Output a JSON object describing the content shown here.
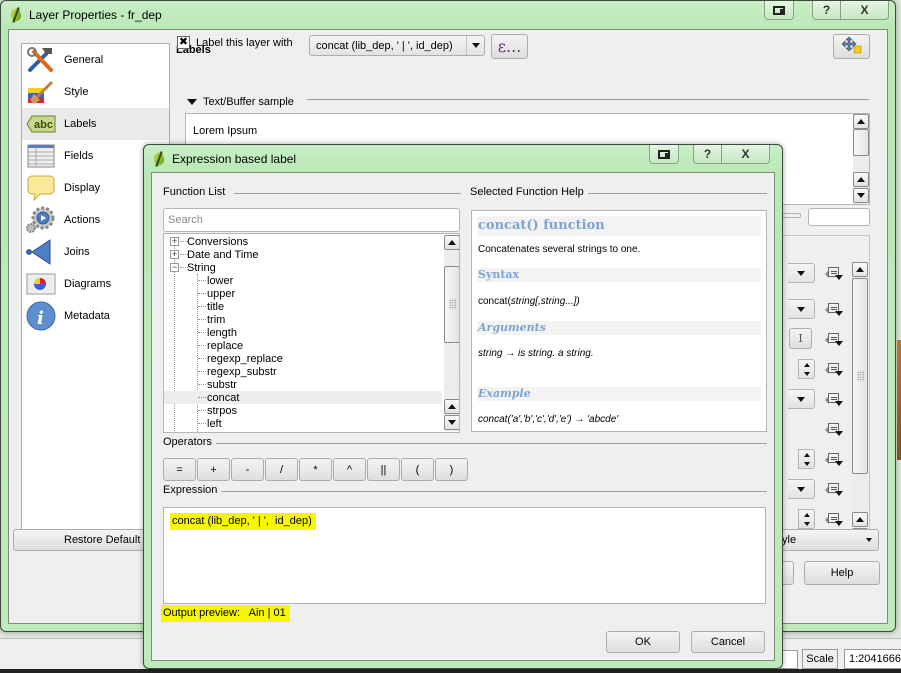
{
  "layer_properties": {
    "title": "Layer Properties - fr_dep",
    "caption": {
      "help": "?",
      "close": "X"
    },
    "sidebar": {
      "items": [
        {
          "label": "General",
          "icon": "hammer-wrench-icon"
        },
        {
          "label": "Style",
          "icon": "paint-brush-icon"
        },
        {
          "label": "Labels",
          "icon": "abc-label-icon",
          "active": true
        },
        {
          "label": "Fields",
          "icon": "table-icon"
        },
        {
          "label": "Display",
          "icon": "speech-bubble-icon"
        },
        {
          "label": "Actions",
          "icon": "gear-play-icon"
        },
        {
          "label": "Joins",
          "icon": "join-arrow-icon"
        },
        {
          "label": "Diagrams",
          "icon": "pie-chart-map-icon"
        },
        {
          "label": "Metadata",
          "icon": "info-icon"
        }
      ]
    },
    "labels_section": {
      "heading": "Labels",
      "checkbox_label": "Label this layer with",
      "checked": true,
      "label_field_value": "concat (lib_dep, ' | ',  id_dep)",
      "expression_button": "ε...",
      "sample_header": "Text/Buffer sample",
      "sample_text": "Lorem Ipsum"
    },
    "buttons": {
      "restore_defaults": "Restore Default",
      "style": "yle",
      "help": "Help"
    }
  },
  "statusbar": {
    "scale_label": "Scale",
    "scale_value": "1:2041666"
  },
  "expression_dialog": {
    "title": "Expression based label",
    "caption": {
      "help": "?",
      "close": "X"
    },
    "function_list": {
      "label": "Function List",
      "search_placeholder": "Search",
      "groups": [
        {
          "label": "Conversions",
          "expanded": false
        },
        {
          "label": "Date and Time",
          "expanded": false
        },
        {
          "label": "String",
          "expanded": true
        }
      ],
      "string_functions": [
        "lower",
        "upper",
        "title",
        "trim",
        "length",
        "replace",
        "regexp_replace",
        "regexp_substr",
        "substr",
        "concat",
        "strpos",
        "left"
      ],
      "selected": "concat"
    },
    "help": {
      "label": "Selected Function Help",
      "title": "concat() function",
      "description": "Concatenates several strings to one.",
      "syntax_heading": "Syntax",
      "syntax_fn": "concat(",
      "syntax_args": "string[,string...])",
      "arguments_heading": "Arguments",
      "arguments_text": "string → is string. a string.",
      "example_heading": "Example",
      "example_text": "concat('a','b','c','d','e') → 'abcde'"
    },
    "operators": {
      "label": "Operators",
      "buttons": [
        "=",
        "+",
        "-",
        "/",
        "*",
        "^",
        "||",
        "(",
        ")"
      ]
    },
    "expression": {
      "label": "Expression",
      "value": "concat (lib_dep, ' | ',  id_dep)"
    },
    "output_preview": {
      "label": "Output preview:",
      "value": "Ain | 01"
    },
    "buttons": {
      "ok": "OK",
      "cancel": "Cancel"
    },
    "highlight_color": "#f7f700"
  }
}
